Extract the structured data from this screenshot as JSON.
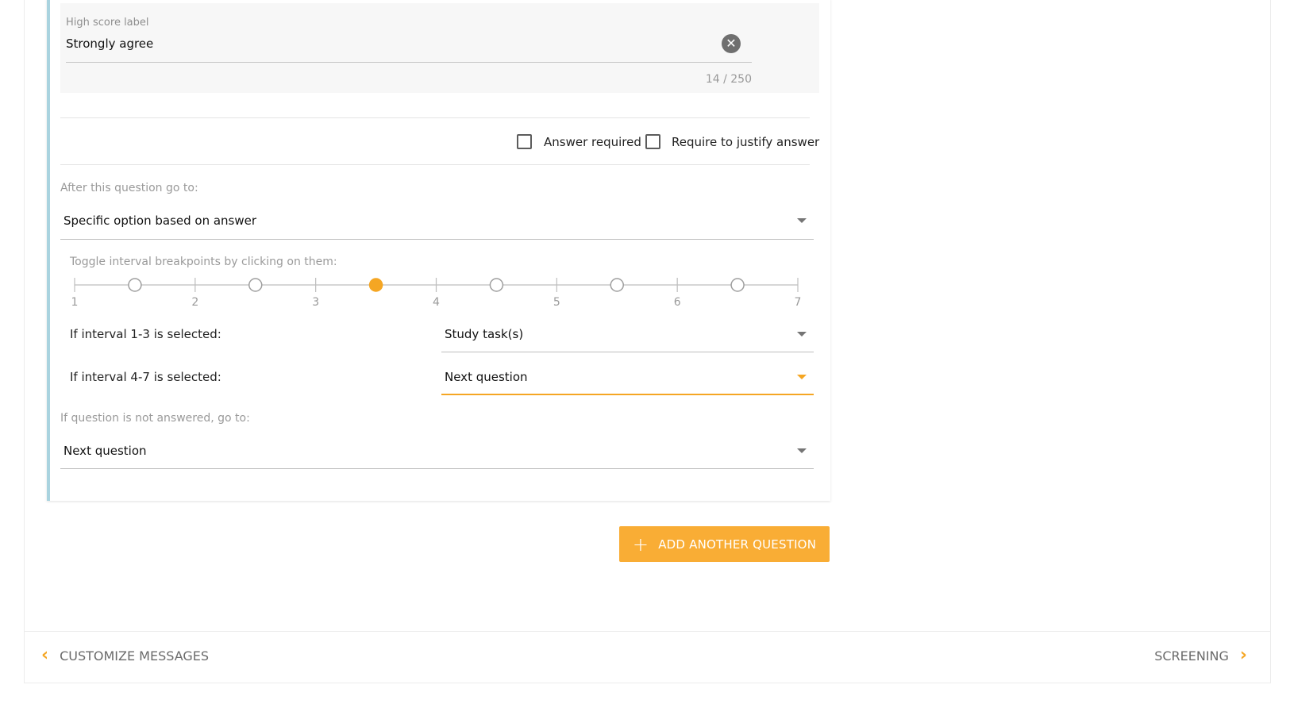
{
  "high_score": {
    "label": "High score label",
    "value": "Strongly agree",
    "counter": "14 / 250"
  },
  "options": {
    "answer_required": "Answer required",
    "require_justify": "Require to justify answer"
  },
  "after_question": {
    "label": "After this question go to:",
    "selected": "Specific option based on answer"
  },
  "breakpoints": {
    "label": "Toggle interval breakpoints by clicking on them:",
    "ticks": [
      "1",
      "2",
      "3",
      "4",
      "5",
      "6",
      "7"
    ],
    "active_breakpoint_index": 2,
    "accent_color": "#f5a623"
  },
  "intervals": [
    {
      "label": "If interval 1-3 is selected:",
      "selected": "Study task(s)"
    },
    {
      "label": "If interval 4-7 is selected:",
      "selected": "Next question"
    }
  ],
  "not_answered": {
    "label": "If question is not answered, go to:",
    "selected": "Next question"
  },
  "add_button": {
    "label": "ADD ANOTHER QUESTION",
    "icon": "plus-icon"
  },
  "nav": {
    "prev_label": "CUSTOMIZE MESSAGES",
    "next_label": "SCREENING"
  }
}
